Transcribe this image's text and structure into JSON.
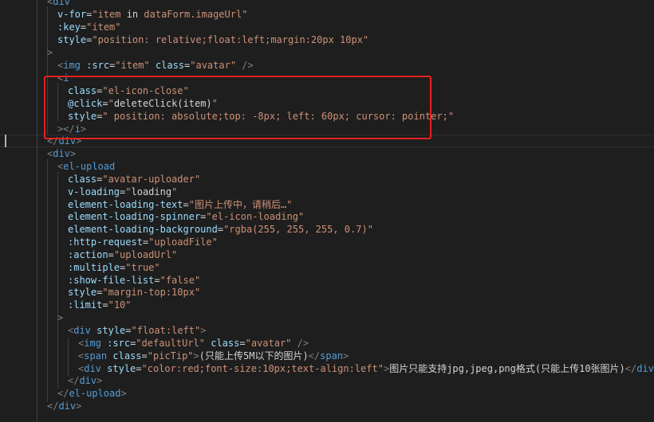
{
  "colors": {
    "background": "#1e1e1e",
    "punctuation": "#808080",
    "tag": "#569cd6",
    "attribute": "#9cdcfe",
    "string": "#ce9178",
    "text": "#d4d4d4",
    "highlight_border": "#e8201e"
  },
  "code": {
    "lines": [
      [
        [
          "p",
          "<"
        ],
        [
          "t",
          "div"
        ]
      ],
      [
        [
          "a",
          "v-for"
        ],
        [
          "x",
          "="
        ],
        [
          "s",
          "\"item"
        ],
        [
          "x",
          " in "
        ],
        [
          "s",
          "dataForm.imageUrl\""
        ]
      ],
      [
        [
          "a",
          ":key"
        ],
        [
          "x",
          "="
        ],
        [
          "s",
          "\"item\""
        ]
      ],
      [
        [
          "a",
          "style"
        ],
        [
          "x",
          "="
        ],
        [
          "s",
          "\"position: relative;float:left;margin:20px 10px\""
        ]
      ],
      [
        [
          "p",
          ">"
        ]
      ],
      [
        [
          "p",
          "<"
        ],
        [
          "t",
          "img"
        ],
        [
          "x",
          " "
        ],
        [
          "a",
          ":src"
        ],
        [
          "x",
          "="
        ],
        [
          "s",
          "\"item\""
        ],
        [
          "x",
          " "
        ],
        [
          "a",
          "class"
        ],
        [
          "x",
          "="
        ],
        [
          "s",
          "\"avatar\""
        ],
        [
          "x",
          " "
        ],
        [
          "p",
          "/>"
        ]
      ],
      [
        [
          "p",
          "<"
        ],
        [
          "t",
          "i"
        ]
      ],
      [
        [
          "a",
          "class"
        ],
        [
          "x",
          "="
        ],
        [
          "s",
          "\"el-icon-close\""
        ]
      ],
      [
        [
          "a",
          "@click"
        ],
        [
          "x",
          "="
        ],
        [
          "s",
          "\""
        ],
        [
          "x",
          "deleteClick(item)"
        ],
        [
          "s",
          "\""
        ]
      ],
      [
        [
          "a",
          "style"
        ],
        [
          "x",
          "="
        ],
        [
          "s",
          "\" position: absolute;top: -8px; left: 60px; cursor: pointer;\""
        ]
      ],
      [
        [
          "p",
          "></"
        ],
        [
          "t",
          "i"
        ],
        [
          "p",
          ">"
        ]
      ],
      [
        [
          "p",
          "</"
        ],
        [
          "t",
          "div"
        ],
        [
          "p",
          ">"
        ]
      ],
      [
        [
          "p",
          "<"
        ],
        [
          "t",
          "div"
        ],
        [
          "p",
          ">"
        ]
      ],
      [
        [
          "p",
          "<"
        ],
        [
          "t",
          "el-upload"
        ]
      ],
      [
        [
          "a",
          "class"
        ],
        [
          "x",
          "="
        ],
        [
          "s",
          "\"avatar-uploader\""
        ]
      ],
      [
        [
          "a",
          "v-loading"
        ],
        [
          "x",
          "="
        ],
        [
          "s",
          "\""
        ],
        [
          "x",
          "loading"
        ],
        [
          "s",
          "\""
        ]
      ],
      [
        [
          "a",
          "element-loading-text"
        ],
        [
          "x",
          "="
        ],
        [
          "s",
          "\"图片上传中，请稍后…\""
        ]
      ],
      [
        [
          "a",
          "element-loading-spinner"
        ],
        [
          "x",
          "="
        ],
        [
          "s",
          "\"el-icon-loading\""
        ]
      ],
      [
        [
          "a",
          "element-loading-background"
        ],
        [
          "x",
          "="
        ],
        [
          "s",
          "\"rgba(255, 255, 255, 0.7)\""
        ]
      ],
      [
        [
          "a",
          ":http-request"
        ],
        [
          "x",
          "="
        ],
        [
          "s",
          "\"uploadFile\""
        ]
      ],
      [
        [
          "a",
          ":action"
        ],
        [
          "x",
          "="
        ],
        [
          "s",
          "\"uploadUrl\""
        ]
      ],
      [
        [
          "a",
          ":multiple"
        ],
        [
          "x",
          "="
        ],
        [
          "s",
          "\"true\""
        ]
      ],
      [
        [
          "a",
          ":show-file-list"
        ],
        [
          "x",
          "="
        ],
        [
          "s",
          "\"false\""
        ]
      ],
      [
        [
          "a",
          "style"
        ],
        [
          "x",
          "="
        ],
        [
          "s",
          "\"margin-top:10px\""
        ]
      ],
      [
        [
          "a",
          ":limit"
        ],
        [
          "x",
          "="
        ],
        [
          "s",
          "\"10\""
        ]
      ],
      [
        [
          "p",
          ">"
        ]
      ],
      [
        [
          "p",
          "<"
        ],
        [
          "t",
          "div"
        ],
        [
          "x",
          " "
        ],
        [
          "a",
          "style"
        ],
        [
          "x",
          "="
        ],
        [
          "s",
          "\"float:left\""
        ],
        [
          "p",
          ">"
        ]
      ],
      [
        [
          "p",
          "<"
        ],
        [
          "t",
          "img"
        ],
        [
          "x",
          " "
        ],
        [
          "a",
          ":src"
        ],
        [
          "x",
          "="
        ],
        [
          "s",
          "\"defaultUrl\""
        ],
        [
          "x",
          " "
        ],
        [
          "a",
          "class"
        ],
        [
          "x",
          "="
        ],
        [
          "s",
          "\"avatar\""
        ],
        [
          "x",
          " "
        ],
        [
          "p",
          "/>"
        ]
      ],
      [
        [
          "p",
          "<"
        ],
        [
          "t",
          "span"
        ],
        [
          "x",
          " "
        ],
        [
          "a",
          "class"
        ],
        [
          "x",
          "="
        ],
        [
          "s",
          "\"picTip\""
        ],
        [
          "p",
          ">"
        ],
        [
          "x",
          "(只能上传5M以下的图片)"
        ],
        [
          "p",
          "</"
        ],
        [
          "t",
          "span"
        ],
        [
          "p",
          ">"
        ]
      ],
      [
        [
          "p",
          "<"
        ],
        [
          "t",
          "div"
        ],
        [
          "x",
          " "
        ],
        [
          "a",
          "style"
        ],
        [
          "x",
          "="
        ],
        [
          "s",
          "\"color:red;font-size:10px;text-align:left\""
        ],
        [
          "p",
          ">"
        ],
        [
          "x",
          "图片只能支持jpg,jpeg,png格式(只能上传10张图片)"
        ],
        [
          "p",
          "</"
        ],
        [
          "t",
          "div"
        ],
        [
          "p",
          ">"
        ]
      ],
      [
        [
          "p",
          "</"
        ],
        [
          "t",
          "div"
        ],
        [
          "p",
          ">"
        ]
      ],
      [
        [
          "p",
          "</"
        ],
        [
          "t",
          "el-upload"
        ],
        [
          "p",
          ">"
        ]
      ],
      [
        [
          "p",
          "</"
        ],
        [
          "t",
          "div"
        ],
        [
          "p",
          ">"
        ]
      ]
    ]
  }
}
